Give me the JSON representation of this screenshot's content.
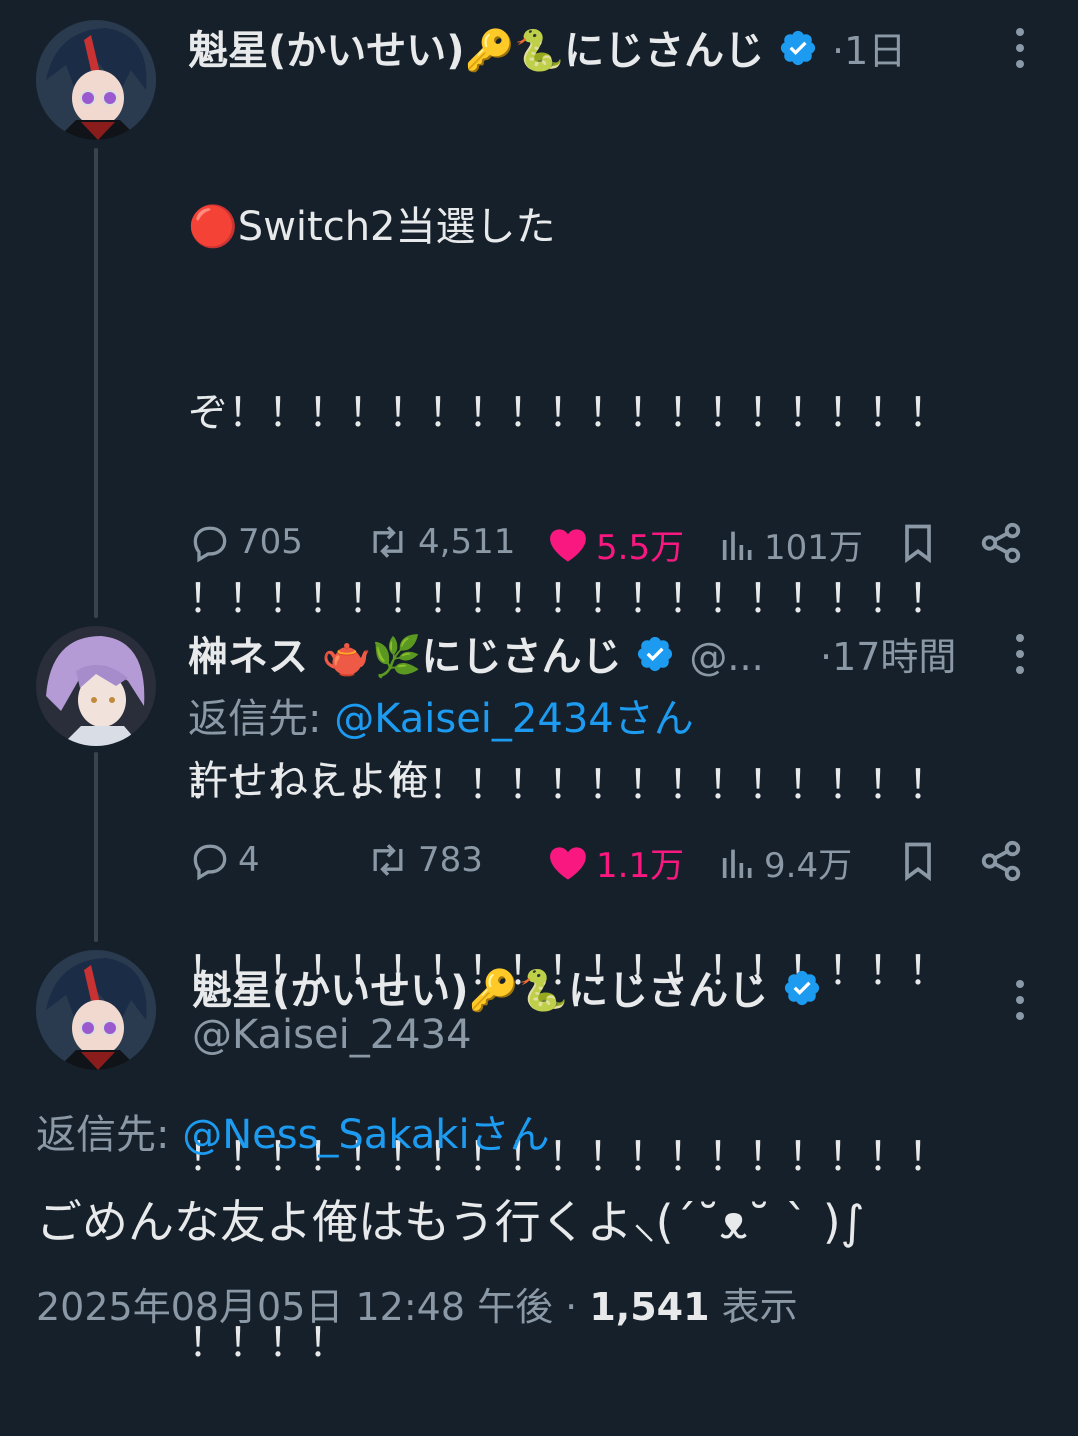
{
  "tweet1": {
    "name": "魁星(かいせい)🔑🐍にじさんじ",
    "time": "·1日",
    "lines": [
      "🔴Switch2当選した",
      "ぞ！！！！！！！！！！！！！！！！！！",
      "！！！！！！！！！！！！！！！！！！！",
      "！！！！！！！！！！！！！！！！！！！",
      "！！！！！！！！！！！！！！！！！！！",
      "！！！！！！！！！！！！！！！！！！！",
      "！！！！"
    ],
    "replies": "705",
    "retweets": "4,511",
    "likes": "5.5万",
    "views": "101万"
  },
  "tweet2": {
    "name": "榊ネス 🫖🌿にじさんじ",
    "handle": "@...",
    "time": "·17時間",
    "reply_prefix": "返信先: ",
    "reply_to": "@Kaisei_2434さん",
    "text": "許せねえよ俺",
    "replies": "4",
    "retweets": "783",
    "likes": "1.1万",
    "views": "9.4万"
  },
  "tweet3": {
    "name": "魁星(かいせい)🔑🐍にじさんじ",
    "handle": "@Kaisei_2434",
    "reply_prefix": "返信先: ",
    "reply_to": "@Ness_Sakakiさん",
    "text": "ごめんな友よ俺はもう行くよ⸜(´˘ᴥ˘ ` )∫",
    "timestamp": "2025年08月05日 12:48 午後 · ",
    "view_count": "1,541",
    "view_label": " 表示"
  },
  "colors": {
    "background": "#15202b",
    "text": "#e7e9ea",
    "muted": "#8b98a5",
    "link": "#1d9bf0",
    "like": "#f91880",
    "verified": "#1d9bf0"
  }
}
